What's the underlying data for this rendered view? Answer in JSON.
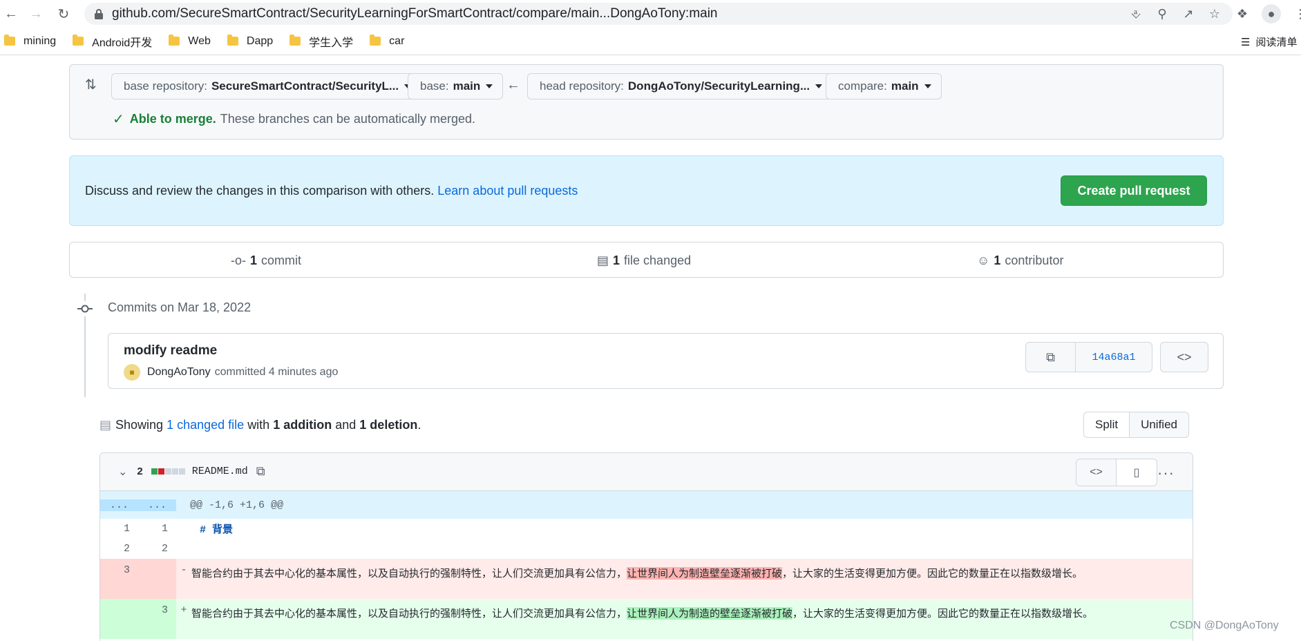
{
  "browser": {
    "url": "github.com/SecureSmartContract/SecurityLearningForSmartContract/compare/main...DongAoTony:main",
    "bookmarks": [
      "mining",
      "Android开发",
      "Web",
      "Dapp",
      "学生入学",
      "car"
    ],
    "reading_list": "阅读清单"
  },
  "compare": {
    "base_repo_label": "base repository:",
    "base_repo_value": "SecureSmartContract/SecurityL...",
    "base_label": "base:",
    "base_value": "main",
    "head_repo_label": "head repository:",
    "head_repo_value": "DongAoTony/SecurityLearning...",
    "compare_label": "compare:",
    "compare_value": "main",
    "merge_status": "Able to merge.",
    "merge_detail": "These branches can be automatically merged."
  },
  "discuss": {
    "text": "Discuss and review the changes in this comparison with others.",
    "link": "Learn about pull requests",
    "button": "Create pull request"
  },
  "stats": {
    "commits_count": "1",
    "commits_label": "commit",
    "files_count": "1",
    "files_label": "file changed",
    "contributors_count": "1",
    "contributors_label": "contributor"
  },
  "commits": {
    "date_header": "Commits on Mar 18, 2022",
    "title": "modify readme",
    "author": "DongAoTony",
    "time": "committed 4 minutes ago",
    "sha": "14a68a1"
  },
  "summary": {
    "prefix": "Showing",
    "changed_files": "1 changed file",
    "with": "with",
    "additions": "1 addition",
    "and": "and",
    "deletions": "1 deletion",
    "end": ".",
    "split": "Split",
    "unified": "Unified"
  },
  "file": {
    "changes": "2",
    "name": "README.md",
    "hunk_header": "@@ -1,6 +1,6 @@",
    "hunk_ellipsis": "...",
    "lines": [
      {
        "old": "1",
        "new": "1",
        "text": "# 背景"
      },
      {
        "old": "2",
        "new": "2",
        "text": ""
      }
    ],
    "deleted": {
      "old": "3",
      "marker": "-",
      "before": "智能合约由于其去中心化的基本属性，以及自动执行的强制特性，让人们交流更加具有公信力，",
      "highlight": "让世界间人为制造壁垒逐渐被打破",
      "after": "，让大家的生活变得更加方便。因此它的数量正在以指数级增长。"
    },
    "added": {
      "new": "3",
      "marker": "+",
      "before": "智能合约由于其去中心化的基本属性，以及自动执行的强制特性，让人们交流更加具有公信力，",
      "highlight": "让世界间人为制造的壁垒逐渐被打破",
      "after": "，让大家的生活变得更加方便。因此它的数量正在以指数级增长。"
    }
  },
  "watermark": "CSDN @DongAoTony",
  "colors": {
    "green": "#2da44e",
    "link": "#0969da",
    "del_bg": "#ffebe9",
    "add_bg": "#e6ffec"
  }
}
